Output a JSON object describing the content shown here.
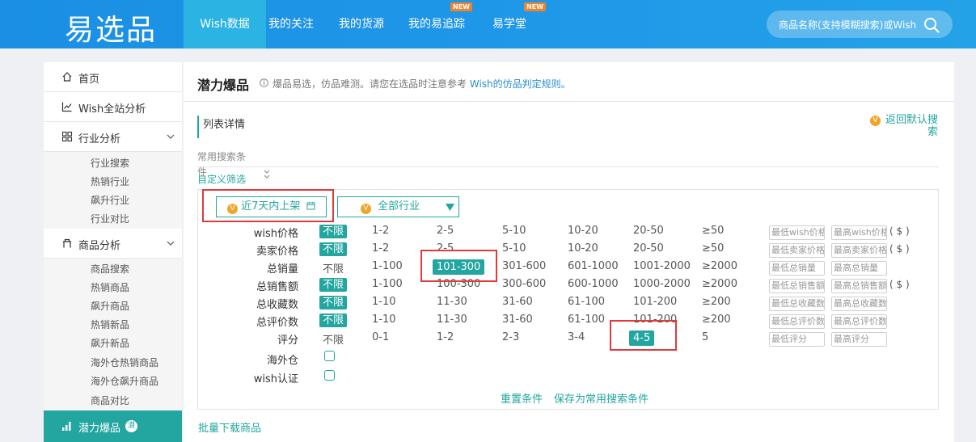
{
  "header": {
    "logo": "易选品",
    "nav": [
      {
        "label": "Wish数据",
        "active": true,
        "badge": ""
      },
      {
        "label": "我的关注",
        "active": false,
        "badge": ""
      },
      {
        "label": "我的货源",
        "active": false,
        "badge": ""
      },
      {
        "label": "我的易追踪",
        "active": false,
        "badge": "NEW"
      },
      {
        "label": "易学堂",
        "active": false,
        "badge": "NEW"
      }
    ],
    "search_placeholder": "商品名称(支持模糊搜索)或Wish"
  },
  "sidebar": {
    "home": "首页",
    "site_analysis": "Wish全站分析",
    "industry": {
      "label": "行业分析",
      "items": [
        "行业搜索",
        "热销行业",
        "飙升行业",
        "行业对比"
      ]
    },
    "product": {
      "label": "商品分析",
      "items": [
        "商品搜索",
        "热销商品",
        "飙升商品",
        "热销新品",
        "飙升新品",
        "海外仓热销商品",
        "海外仓飙升商品",
        "商品对比"
      ]
    },
    "active": {
      "label": "潜力爆品",
      "badge": "潜"
    }
  },
  "main": {
    "title": "潜力爆品",
    "tip": "爆品易选，仿品难测。请您在选品时注意参考",
    "tip_link": "Wish的仿品判定规则。",
    "list_head": "列表详情",
    "back_label": "返回默认搜索",
    "common_label": "常用搜索条件",
    "custom_filter": "自定义筛选",
    "recent_btn": "近7天内上架",
    "industry_btn": "全部行业",
    "badge_v": "V",
    "rows": [
      {
        "label": "wish价格",
        "options": [
          "不限",
          "1-2",
          "2-5",
          "5-10",
          "10-20",
          "20-50",
          "≥50"
        ],
        "selected": 0,
        "min": "最低wish价格",
        "max": "最高wish价格",
        "unit": "( $ )"
      },
      {
        "label": "卖家价格",
        "options": [
          "不限",
          "1-2",
          "2-5",
          "5-10",
          "10-20",
          "20-50",
          "≥50"
        ],
        "selected": 0,
        "min": "最低卖家价格",
        "max": "最高卖家价格",
        "unit": "( $ )"
      },
      {
        "label": "总销量",
        "options": [
          "不限",
          "1-100",
          "101-300",
          "301-600",
          "601-1000",
          "1001-2000",
          "≥2000"
        ],
        "selected": 2,
        "min": "最低总销量",
        "max": "最高总销量",
        "unit": ""
      },
      {
        "label": "总销售额",
        "options": [
          "不限",
          "1-100",
          "100-300",
          "300-600",
          "600-1000",
          "1000-2000",
          "≥2000"
        ],
        "selected": 0,
        "min": "最低总销售额",
        "max": "最高总销售额",
        "unit": "( $ )"
      },
      {
        "label": "总收藏数",
        "options": [
          "不限",
          "1-10",
          "11-30",
          "31-60",
          "61-100",
          "101-200",
          "≥200"
        ],
        "selected": 0,
        "min": "最低总收藏数",
        "max": "最高总收藏数",
        "unit": ""
      },
      {
        "label": "总评价数",
        "options": [
          "不限",
          "1-10",
          "11-30",
          "31-60",
          "61-100",
          "101-200",
          "≥200"
        ],
        "selected": 0,
        "min": "最低总评价数",
        "max": "最高总评价数",
        "unit": ""
      },
      {
        "label": "评分",
        "options": [
          "不限",
          "0-1",
          "1-2",
          "2-3",
          "3-4",
          "4-5",
          "5"
        ],
        "selected": 5,
        "min": "最低评分",
        "max": "最高评分",
        "unit": ""
      }
    ],
    "overseas_label": "海外仓",
    "wish_cert_label": "wish认证",
    "reset": "重置条件",
    "save": "保存为常用搜索条件",
    "batch_download": "批量下载商品"
  },
  "colors": {
    "accent": "#23a6a0",
    "header": "#1f97e8",
    "highlight": "#e03a3a",
    "badge": "#f0a52b"
  }
}
